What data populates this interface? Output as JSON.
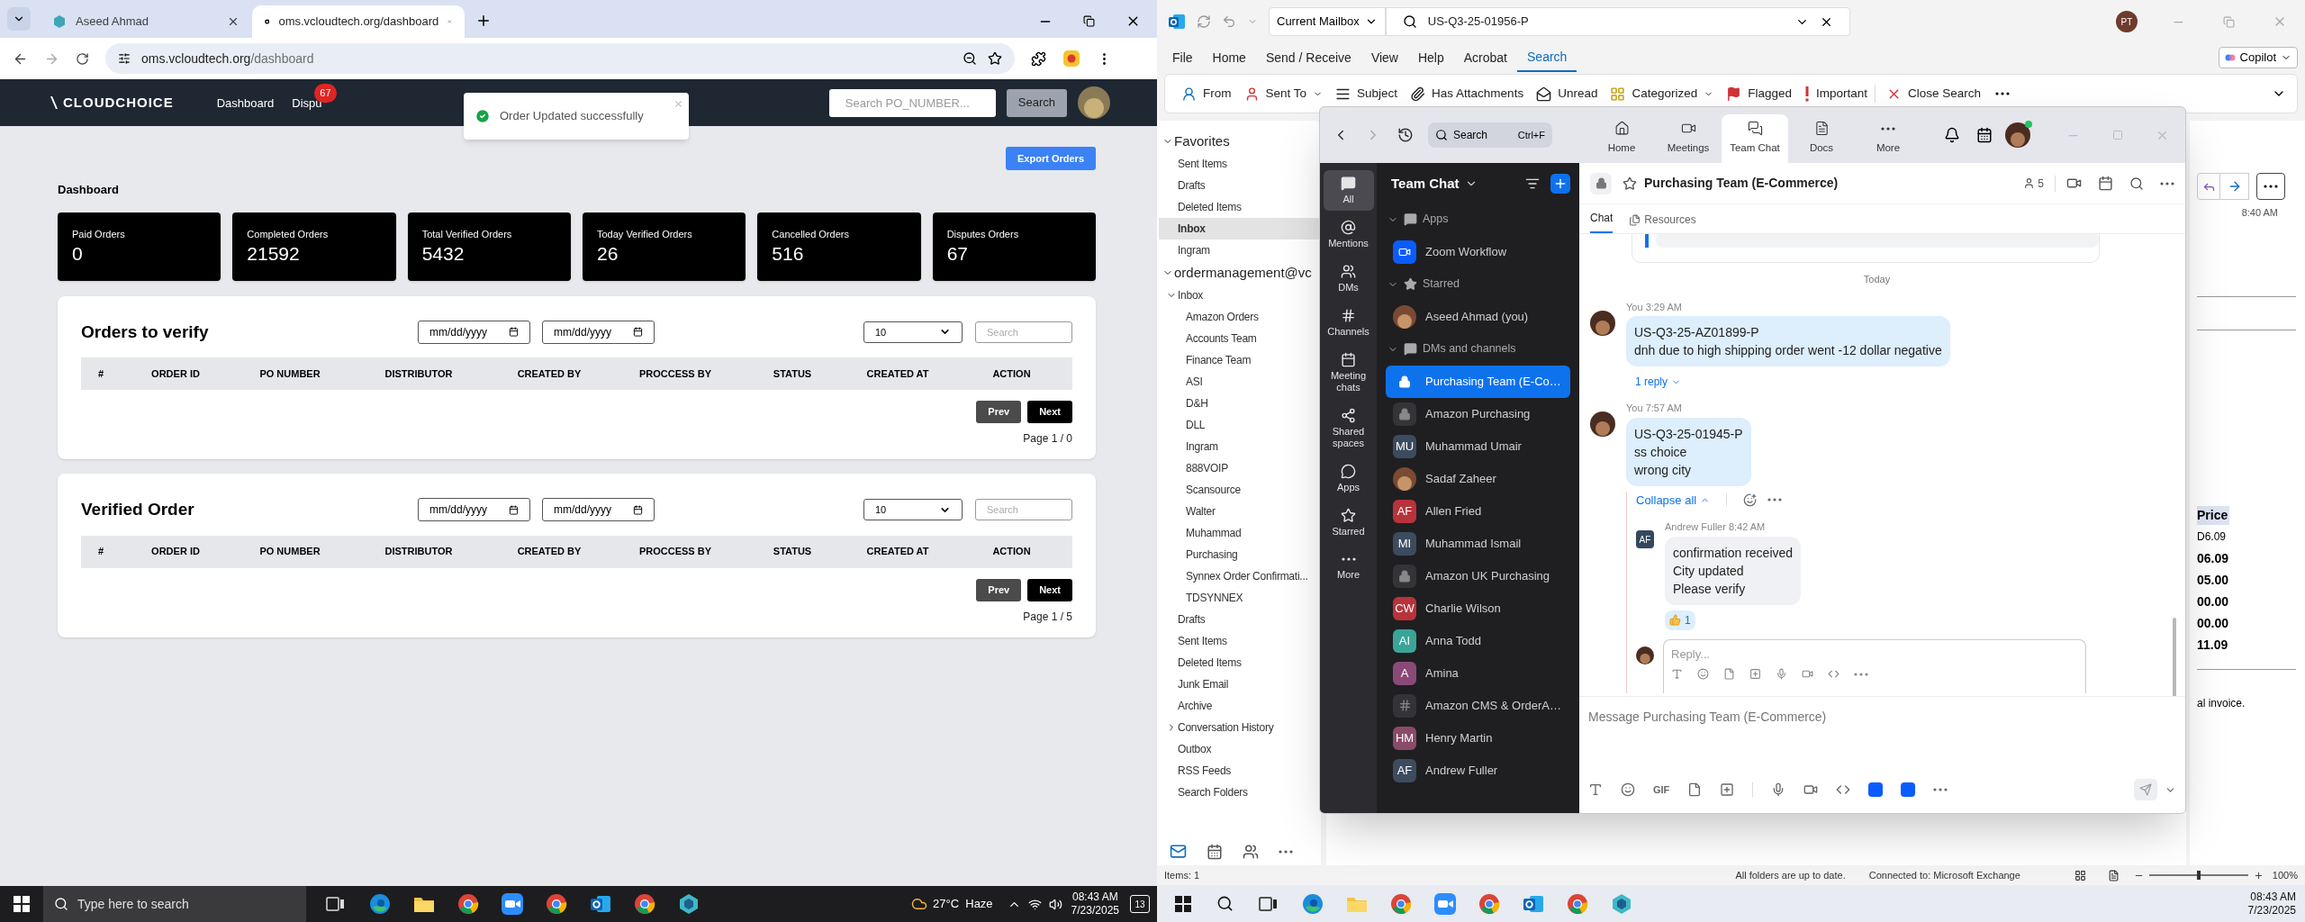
{
  "left_screen": {
    "browser": {
      "tabs": [
        {
          "title": "Aseed Ahmad",
          "selected": false
        },
        {
          "title": "oms.vcloudtech.org/dashboard",
          "selected": true
        }
      ],
      "url_host": "oms.vcloudtech.org",
      "url_path": "/dashboard"
    },
    "header": {
      "logo": "CLOUDCHOICE",
      "nav": [
        {
          "label": "Dashboard"
        },
        {
          "label": "Dispu",
          "badge": "67"
        }
      ],
      "search_placeholder": "Search PO_NUMBER...",
      "search_button": "Search"
    },
    "toast": "Order Updated successfully",
    "export_button": "Export Orders",
    "heading": "Dashboard",
    "stats": [
      {
        "label": "Paid Orders",
        "value": "0"
      },
      {
        "label": "Completed Orders",
        "value": "21592"
      },
      {
        "label": "Total Verified Orders",
        "value": "5432"
      },
      {
        "label": "Today Verified Orders",
        "value": "26"
      },
      {
        "label": "Cancelled Orders",
        "value": "516"
      },
      {
        "label": "Disputes Orders",
        "value": "67"
      }
    ],
    "tables": [
      {
        "title": "Orders to verify",
        "date_from": "mm/dd/yyyy",
        "date_to": "mm/dd/yyyy",
        "page_size": "10",
        "search_placeholder": "Search",
        "columns": [
          "#",
          "ORDER ID",
          "PO NUMBER",
          "DISTRIBUTOR",
          "CREATED BY",
          "PROCCESS BY",
          "STATUS",
          "CREATED AT",
          "ACTION"
        ],
        "prev": "Prev",
        "next": "Next",
        "page": "Page 1 / 0"
      },
      {
        "title": "Verified Order",
        "date_from": "mm/dd/yyyy",
        "date_to": "mm/dd/yyyy",
        "page_size": "10",
        "search_placeholder": "Search",
        "columns": [
          "#",
          "ORDER ID",
          "PO NUMBER",
          "DISTRIBUTOR",
          "CREATED BY",
          "PROCCESS BY",
          "STATUS",
          "CREATED AT",
          "ACTION"
        ],
        "prev": "Prev",
        "next": "Next",
        "page": "Page 1 / 5"
      }
    ],
    "taskbar": {
      "search_placeholder": "Type here to search",
      "apps": [
        {
          "kind": "task-view"
        },
        {
          "kind": "edge"
        },
        {
          "kind": "files"
        },
        {
          "kind": "chrome"
        },
        {
          "kind": "meeting"
        },
        {
          "kind": "chrome"
        },
        {
          "kind": "mail"
        },
        {
          "kind": "chrome"
        },
        {
          "kind": "app"
        }
      ],
      "weather": "27°C  Haze",
      "time": "08:43 AM",
      "date": "7/23/2025",
      "notifications": "13"
    }
  },
  "right_screen": {
    "outlook": {
      "mailbox_scope": "Current Mailbox",
      "search_value": "US-Q3-25-01956-P",
      "avatar": "PT",
      "menu": [
        {
          "label": "File",
          "selected": false
        },
        {
          "label": "Home",
          "selected": false
        },
        {
          "label": "Send / Receive",
          "selected": false
        },
        {
          "label": "View",
          "selected": false
        },
        {
          "label": "Help",
          "selected": false
        },
        {
          "label": "Acrobat",
          "selected": false
        },
        {
          "label": "Search",
          "selected": true
        }
      ],
      "copilot": "Copilot",
      "ribbon": [
        {
          "label": "From",
          "dropdown": false
        },
        {
          "label": "Sent To",
          "dropdown": true
        },
        {
          "label": "Subject",
          "dropdown": false
        },
        {
          "label": "Has Attachments",
          "dropdown": false
        },
        {
          "label": "Unread",
          "dropdown": false
        },
        {
          "label": "Categorized",
          "dropdown": true
        },
        {
          "label": "Flagged",
          "dropdown": false
        },
        {
          "label": "Important",
          "dropdown": false
        },
        {
          "label": "Close Search",
          "dropdown": false
        }
      ],
      "folders": [
        {
          "label": "Favorites",
          "expanded": true,
          "children": [
            {
              "label": "Sent Items",
              "selected": false
            },
            {
              "label": "Drafts",
              "selected": false
            },
            {
              "label": "Deleted Items",
              "selected": false
            },
            {
              "label": "Inbox",
              "selected": true
            },
            {
              "label": "Ingram",
              "selected": false
            }
          ]
        },
        {
          "label": "ordermanagement@vc",
          "expanded": true,
          "children": [
            {
              "label": "Inbox",
              "selected": false,
              "expanded": true,
              "children": [
                {
                  "label": "Amazon Orders",
                  "selected": false
                },
                {
                  "label": "Accounts Team",
                  "selected": false
                },
                {
                  "label": "Finance Team",
                  "selected": false
                },
                {
                  "label": "ASI",
                  "selected": false
                },
                {
                  "label": "D&H",
                  "selected": false
                },
                {
                  "label": "DLL",
                  "selected": false
                },
                {
                  "label": "Ingram",
                  "selected": false
                },
                {
                  "label": "888VOIP",
                  "selected": false
                },
                {
                  "label": "Scansource",
                  "selected": false
                },
                {
                  "label": "Walter",
                  "selected": false
                },
                {
                  "label": "Muhammad",
                  "selected": false
                },
                {
                  "label": "Purchasing",
                  "selected": false
                },
                {
                  "label": "Synnex Order Confirmati...",
                  "selected": false
                },
                {
                  "label": "TDSYNNEX",
                  "selected": false
                }
              ]
            },
            {
              "label": "Drafts",
              "selected": false
            },
            {
              "label": "Sent Items",
              "selected": false
            },
            {
              "label": "Deleted Items",
              "selected": false
            },
            {
              "label": "Junk Email",
              "selected": false
            },
            {
              "label": "Archive",
              "selected": false
            },
            {
              "label": "Conversation History",
              "selected": false,
              "expanded": false
            },
            {
              "label": "Outbox",
              "selected": false
            },
            {
              "label": "RSS Feeds",
              "selected": false
            },
            {
              "label": "Search Folders",
              "selected": false
            }
          ]
        }
      ],
      "reading_pane": {
        "time": "8:40 AM",
        "price_header": "Price",
        "unit_price": "D6.09",
        "totals": [
          "06.09",
          "05.00",
          "00.00",
          "00.00",
          "11.09"
        ],
        "footer_text": "al invoice."
      },
      "status": {
        "items": "Items: 1",
        "sync": "All folders are up to date.",
        "connection": "Connected to: Microsoft Exchange",
        "zoom_slider": {
          "level": 0.5
        },
        "zoom": "100%"
      }
    },
    "zoom": {
      "search": "Search",
      "search_shortcut": "Ctrl+F",
      "tabs": [
        {
          "label": "Home",
          "selected": false
        },
        {
          "label": "Meetings",
          "selected": false
        },
        {
          "label": "Team Chat",
          "selected": true
        },
        {
          "label": "Docs",
          "selected": false
        },
        {
          "label": "More",
          "selected": false
        }
      ],
      "rail": [
        {
          "label": "All",
          "selected": true
        },
        {
          "label": "Mentions",
          "selected": false
        },
        {
          "label": "DMs",
          "selected": false
        },
        {
          "label": "Channels",
          "selected": false
        },
        {
          "label": "Meeting chats",
          "selected": false
        },
        {
          "label": "Shared spaces",
          "selected": false
        },
        {
          "label": "Apps",
          "selected": false
        },
        {
          "label": "Starred",
          "selected": false
        },
        {
          "label": "More",
          "selected": false
        }
      ],
      "sidebar": {
        "title": "Team Chat",
        "sections": [
          {
            "label": "Apps",
            "items": [
              {
                "name": "Zoom Workflow",
                "kind": "app",
                "selected": false
              }
            ]
          },
          {
            "label": "Starred",
            "items": [
              {
                "name": "Aseed Ahmad (you)",
                "kind": "picture",
                "selected": false
              }
            ]
          },
          {
            "label": "DMs and channels",
            "items": [
              {
                "name": "Purchasing Team (E-Co…",
                "kind": "private",
                "selected": true
              },
              {
                "name": "Amazon Purchasing",
                "kind": "private",
                "selected": false
              },
              {
                "name": "Muhammad Umair",
                "kind": "initials",
                "initials": "MU",
                "color": "#3d4b5f",
                "selected": false
              },
              {
                "name": "Sadaf Zaheer",
                "kind": "picture",
                "selected": false
              },
              {
                "name": "Allen Fried",
                "kind": "initials",
                "initials": "AF",
                "color": "#b7343a",
                "selected": false
              },
              {
                "name": "Muhammad Ismail",
                "kind": "initials",
                "initials": "MI",
                "color": "#3d4b5f",
                "selected": false
              },
              {
                "name": "Amazon UK Purchasing",
                "kind": "private",
                "selected": false
              },
              {
                "name": "Charlie Wilson",
                "kind": "initials",
                "initials": "CW",
                "color": "#b7343a",
                "selected": false
              },
              {
                "name": "Anna Todd",
                "kind": "initials",
                "initials": "AI",
                "color": "#3aa597",
                "selected": false
              },
              {
                "name": "Amina",
                "kind": "initials",
                "initials": "A",
                "color": "#8a4a78",
                "selected": false
              },
              {
                "name": "Amazon CMS & OrderA…",
                "kind": "channel",
                "selected": false
              },
              {
                "name": "Henry Martin",
                "kind": "initials",
                "initials": "HM",
                "color": "#8a4a6a",
                "selected": false
              },
              {
                "name": "Andrew Fuller",
                "kind": "initials",
                "initials": "AF",
                "color": "#3d4b5f",
                "selected": false
              }
            ]
          }
        ]
      },
      "channel": {
        "title": "Purchasing Team (E-Commerce)",
        "members": "5",
        "tabs": [
          {
            "label": "Chat",
            "selected": true
          },
          {
            "label": "Resources",
            "selected": false
          }
        ],
        "date_divider": "Today",
        "messages": [
          {
            "author": "You",
            "time": "3:29 AM",
            "lines": [
              "US-Q3-25-AZ01899-P",
              "dnh due to high shipping order went -12 dollar negative"
            ],
            "replies_link": "1 reply"
          },
          {
            "author": "You",
            "time": "7:57 AM",
            "lines": [
              "US-Q3-25-01945-P",
              "ss choice",
              "wrong city"
            ],
            "thread": {
              "collapse": "Collapse all",
              "replies": [
                {
                  "author": "Andrew Fuller",
                  "time": "8:42 AM",
                  "initials": "AF",
                  "lines": [
                    "confirmation received",
                    "City updated",
                    "Please verify"
                  ],
                  "reaction_count": "1"
                }
              ],
              "reply_placeholder": "Reply..."
            }
          }
        ],
        "composer_placeholder": "Message Purchasing Team (E-Commerce)",
        "gif": "GIF"
      }
    },
    "taskbar": {
      "apps": [
        {
          "kind": "task-view"
        },
        {
          "kind": "edge"
        },
        {
          "kind": "files"
        },
        {
          "kind": "chrome"
        },
        {
          "kind": "meeting"
        },
        {
          "kind": "chrome"
        },
        {
          "kind": "mail"
        },
        {
          "kind": "chrome"
        },
        {
          "kind": "app"
        }
      ],
      "time": "08:43 AM",
      "date": "7/23/2025"
    }
  }
}
